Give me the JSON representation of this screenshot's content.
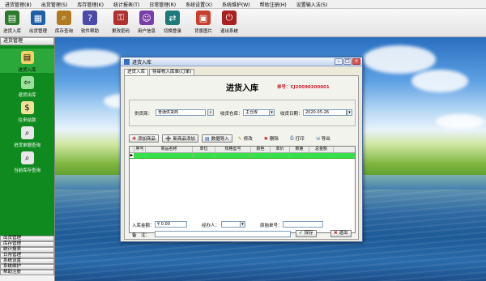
{
  "menu": [
    "进货管理(B)",
    "出货管理(S)",
    "库存管理(K)",
    "统计报表(T)",
    "日常管理(R)",
    "系统设置(X)",
    "系统维护(W)",
    "帮助注册(H)",
    "设置输入法(S)"
  ],
  "toolbar": [
    {
      "label": "进货入库",
      "icon": "inbound-icon",
      "color": "#2c7a2c",
      "glyph": "▤"
    },
    {
      "label": "出货管理",
      "icon": "outbound-icon",
      "color": "#1f5fa8",
      "glyph": "▦"
    },
    {
      "label": "库存查询",
      "icon": "search-icon",
      "color": "#b07a20",
      "glyph": "⌕"
    },
    {
      "label": "软件帮助",
      "icon": "help-icon",
      "color": "#4a4aa8",
      "glyph": "?"
    },
    {
      "label": "更改密码",
      "icon": "password-icon",
      "color": "#b03030",
      "glyph": "⚿"
    },
    {
      "label": "用户信息",
      "icon": "user-icon",
      "color": "#7a3ea8",
      "glyph": "☺"
    },
    {
      "label": "切换登录",
      "icon": "switch-user-icon",
      "color": "#1e7a7a",
      "glyph": "⇄"
    },
    {
      "label": "背景图片",
      "icon": "wallpaper-icon",
      "color": "#c8402c",
      "glyph": "▣"
    },
    {
      "label": "退出系统",
      "icon": "exit-icon",
      "color": "#a82020",
      "glyph": "⏻"
    }
  ],
  "left_panel": {
    "header": "进货管理",
    "items": [
      {
        "label": "进货入库",
        "icon": "inbound-icon",
        "glyph": "▤",
        "bg": "#f4d26a",
        "selected": true
      },
      {
        "label": "退货出库",
        "icon": "return-icon",
        "glyph": "⇦",
        "bg": "#9be09b",
        "selected": false
      },
      {
        "label": "往来结款",
        "icon": "payment-icon",
        "glyph": "$",
        "bg": "#f2e19a",
        "selected": false
      },
      {
        "label": "进货单据查询",
        "icon": "receipt-search-icon",
        "glyph": "⌕",
        "bg": "#e8e8e8",
        "selected": false
      },
      {
        "label": "当前库存查询",
        "icon": "stock-search-icon",
        "glyph": "⌕",
        "bg": "#e8e8e8",
        "selected": false
      }
    ],
    "bottom": [
      "出货管理",
      "库存管理",
      "统计报表",
      "日常管理",
      "系统设置",
      "系统维护",
      "帮助注册"
    ]
  },
  "window": {
    "title": "进货入库",
    "tabs": [
      "进货入库",
      "待审核入库单(订单)"
    ],
    "heading": "进货入库",
    "doc_no": "单号：CJ20090200001",
    "supplier_label": "供货商：",
    "supplier_value": "普通供货商",
    "warehouse_label": "收货仓库：",
    "warehouse_value": "主仓库",
    "date_label": "收货日期：",
    "date_value": "2020-05-26",
    "actions": [
      {
        "label": "添加商品",
        "glyph": "✚"
      },
      {
        "label": "新商品添加",
        "glyph": "➕"
      },
      {
        "label": "数据导入",
        "glyph": "▤"
      },
      {
        "label": "修改",
        "glyph": "✎",
        "plain": true
      },
      {
        "label": "删除",
        "glyph": "✖",
        "plain": true
      },
      {
        "label": "打印",
        "glyph": "⎙",
        "plain": true
      },
      {
        "label": "导出",
        "glyph": "⇲",
        "plain": true
      }
    ],
    "columns": [
      "序号",
      "商品名称",
      "单位",
      "规格型号",
      "颜色",
      "单价",
      "数量",
      "总金额"
    ],
    "row_pointer": "▶",
    "amount_label": "入库金额：",
    "amount_value": "¥ 0.00",
    "handler_label": "经办人：",
    "ref_label": "原始单号：",
    "remark_label": "备　注：",
    "save_label": "保存",
    "exit_label": "退出"
  }
}
